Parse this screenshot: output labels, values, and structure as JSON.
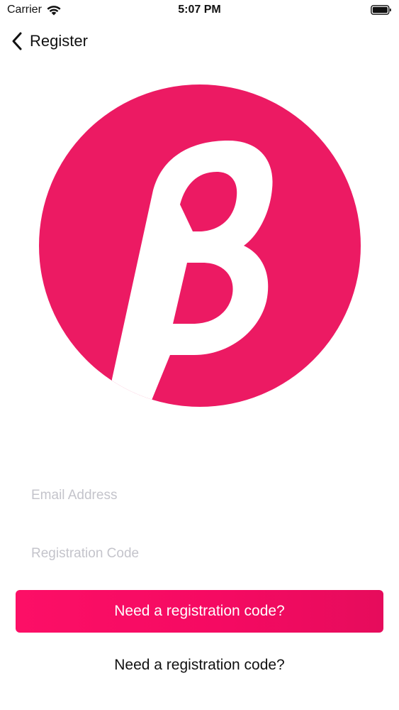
{
  "status_bar": {
    "carrier": "Carrier",
    "time": "5:07 PM",
    "wifi_icon": "wifi-icon",
    "battery_icon": "battery-icon"
  },
  "nav": {
    "back_icon": "chevron-left-icon",
    "title": "Register"
  },
  "logo": {
    "icon": "beta-logo",
    "color": "#EC1A63"
  },
  "form": {
    "email_placeholder": "Email Address",
    "email_value": "",
    "code_placeholder": "Registration Code",
    "code_value": ""
  },
  "buttons": {
    "primary_label": "Need a registration code?",
    "secondary_label": "Need a registration code?"
  },
  "colors": {
    "accent": "#FC0F66",
    "placeholder": "#C4C4CB"
  }
}
